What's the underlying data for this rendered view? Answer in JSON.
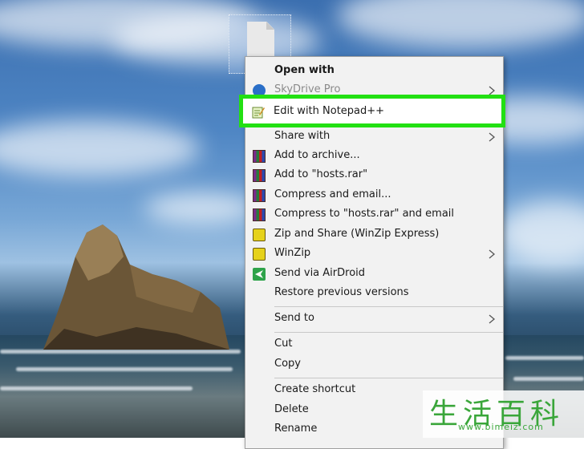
{
  "desktop": {
    "file_icon_name": "document-file-icon"
  },
  "context_menu": {
    "items": [
      {
        "label": "Open with",
        "bold": true,
        "icon": "none",
        "submenu": false
      },
      {
        "label": "SkyDrive Pro",
        "disabled": true,
        "icon": "skydrive-icon",
        "submenu": true
      },
      {
        "label": "Edit with Notepad++",
        "icon": "notepad-plus-plus-icon",
        "submenu": false,
        "highlighted": true
      },
      {
        "label": "Share with",
        "icon": "none",
        "submenu": true
      },
      {
        "label": "Add to archive...",
        "icon": "winrar-icon",
        "submenu": false
      },
      {
        "label": "Add to \"hosts.rar\"",
        "icon": "winrar-icon",
        "submenu": false
      },
      {
        "label": "Compress and email...",
        "icon": "winrar-icon",
        "submenu": false
      },
      {
        "label": "Compress to \"hosts.rar\" and email",
        "icon": "winrar-icon",
        "submenu": false
      },
      {
        "label": "Zip and Share (WinZip Express)",
        "icon": "winzip-icon",
        "submenu": false
      },
      {
        "label": "WinZip",
        "icon": "winzip-icon",
        "submenu": true
      },
      {
        "label": "Send via AirDroid",
        "icon": "airdroid-icon",
        "submenu": false
      },
      {
        "label": "Restore previous versions",
        "icon": "none",
        "submenu": false
      },
      {
        "label": "Send to",
        "icon": "none",
        "submenu": true
      },
      {
        "label": "Cut",
        "icon": "none",
        "submenu": false
      },
      {
        "label": "Copy",
        "icon": "none",
        "submenu": false
      },
      {
        "label": "Create shortcut",
        "icon": "none",
        "submenu": false
      },
      {
        "label": "Delete",
        "icon": "none",
        "submenu": false
      },
      {
        "label": "Rename",
        "icon": "none",
        "submenu": false
      }
    ],
    "highlight_color": "#22e012"
  },
  "watermark": {
    "chars": "生活百科",
    "url": "www.bimeiz.com"
  }
}
